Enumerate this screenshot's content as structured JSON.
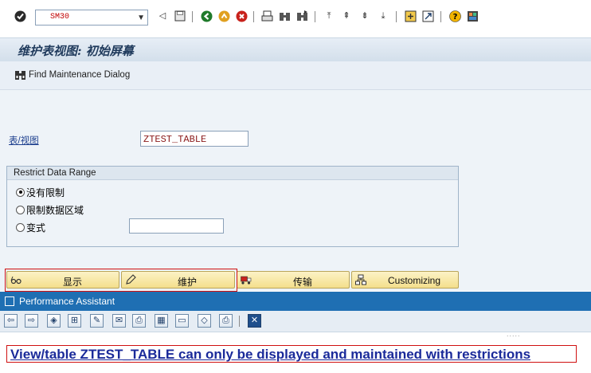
{
  "toolbar": {
    "command_value": "SM30",
    "icons": [
      "enter-icon",
      "save-icon",
      "back-icon",
      "exit-icon",
      "cancel-icon",
      "print-icon",
      "find-icon",
      "find-next-icon",
      "first-page-icon",
      "previous-page-icon",
      "next-page-icon",
      "last-page-icon",
      "create-session-icon",
      "shortcut-icon",
      "help-icon",
      "layout-icon"
    ]
  },
  "title": {
    "text": "维护表视图: 初始屏幕"
  },
  "app_toolbar": {
    "find_maintenance_dialog": "Find Maintenance Dialog"
  },
  "form": {
    "table_view_label": "表/视图",
    "table_view_value": "ZTEST_TABLE",
    "restrict_group_title": "Restrict Data Range",
    "radio_no_restriction": "没有限制",
    "radio_restrict_range": "限制数据区域",
    "radio_variant": "变式",
    "variant_value": ""
  },
  "actions": {
    "display": "显示",
    "maintain": "维护",
    "transport": "传输",
    "customizing": "Customizing"
  },
  "performance_assistant": {
    "title": "Performance Assistant",
    "dots": ".....",
    "message": "View/table ZTEST_TABLE can only be displayed and maintained with restrictions"
  }
}
